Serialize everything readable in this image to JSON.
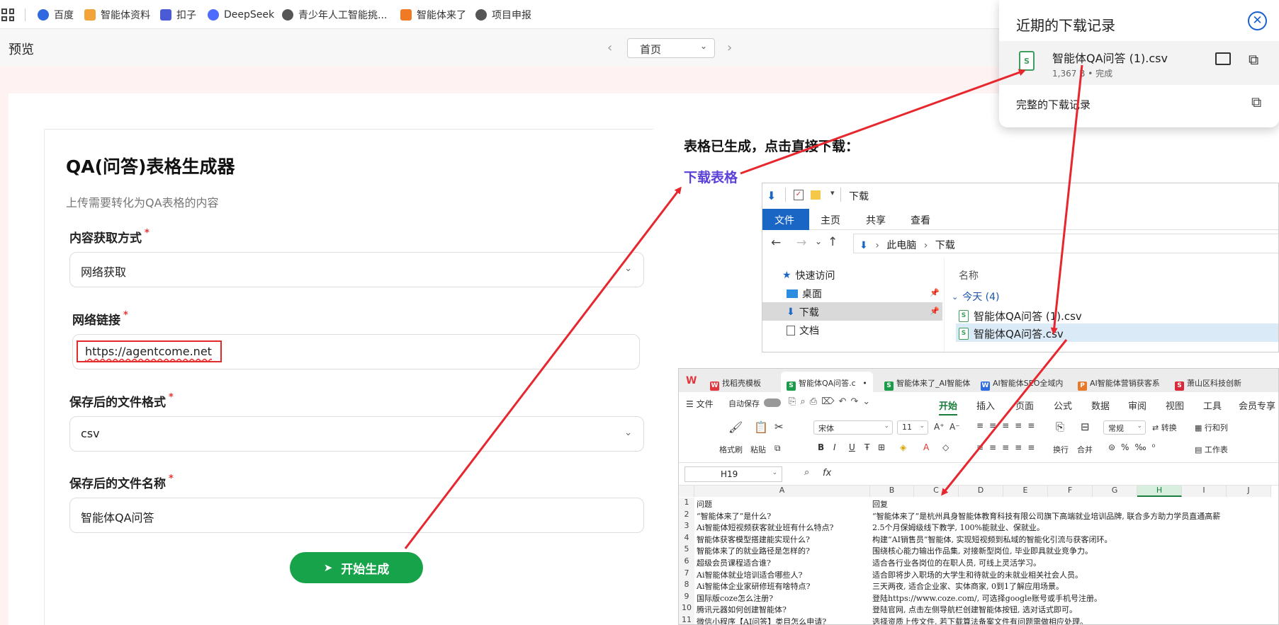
{
  "bookmarks": {
    "items": [
      {
        "label": "百度",
        "color": "#3068e0"
      },
      {
        "label": "智能体资料",
        "color": "#f2a33a"
      },
      {
        "label": "扣子",
        "color": "#4b5bd6"
      },
      {
        "label": "DeepSeek",
        "color": "#4d6bfe"
      },
      {
        "label": "青少年人工智能挑...",
        "color": "#555555"
      },
      {
        "label": "智能体来了",
        "color": "#f07a24"
      },
      {
        "label": "项目申报",
        "color": "#555555"
      }
    ]
  },
  "preview": {
    "title": "预览",
    "page_select": "首页"
  },
  "form": {
    "title": "QA(问答)表格生成器",
    "subtitle": "上传需要转化为QA表格的内容",
    "fields": [
      {
        "label": "内容获取方式",
        "value": "网络获取"
      },
      {
        "label": "网络链接",
        "value": "https://agentcome.net"
      },
      {
        "label": "保存后的文件格式",
        "value": "csv"
      },
      {
        "label": "保存后的文件名称",
        "value": "智能体QA问答"
      }
    ],
    "required_mark": "*",
    "generate_button": "开始生成"
  },
  "result": {
    "ready_text": "表格已生成，点击直接下载：",
    "download_link": "下载表格"
  },
  "downloads_popup": {
    "title": "近期的下载记录",
    "file_name": "智能体QA问答 (1).csv",
    "file_meta": "1,367 B • 完成",
    "full_history": "完整的下载记录"
  },
  "explorer": {
    "title": "下载",
    "ribbon_tabs": [
      "文件",
      "主页",
      "共享",
      "查看"
    ],
    "breadcrumb": [
      "此电脑",
      "下载"
    ],
    "nav": [
      "快速访问",
      "桌面",
      "下载",
      "文档"
    ],
    "column_name": "名称",
    "group": "今天 (4)",
    "files": [
      "智能体QA问答 (1).csv",
      "智能体QA问答.csv"
    ]
  },
  "spreadsheet": {
    "tabs": [
      {
        "label": "找稻壳模板",
        "color": "#e0383e",
        "ico": "W"
      },
      {
        "label": "智能体QA问答.c",
        "color": "#1a9c4b",
        "ico": "S"
      },
      {
        "label": "智能体来了_AI智能体",
        "color": "#1a9c4b",
        "ico": "S"
      },
      {
        "label": "AI智能体SEO全域内",
        "color": "#2d6be0",
        "ico": "W"
      },
      {
        "label": "AI智能体营销获客系",
        "color": "#e8782a",
        "ico": "P"
      },
      {
        "label": "萧山区科技创新",
        "color": "#d8283a",
        "ico": "S"
      }
    ],
    "menu_left": [
      "文件",
      "自动保存"
    ],
    "menu_tabs": [
      "开始",
      "插入",
      "页面",
      "公式",
      "数据",
      "审阅",
      "视图",
      "工具",
      "会员专享"
    ],
    "font_name": "宋体",
    "font_size": "11",
    "number_format": "常规",
    "tool_labels": [
      "格式刷",
      "粘贴",
      "换行",
      "合并",
      "转换",
      "行和列",
      "工作表"
    ],
    "cell_ref": "H19",
    "fx_label": "fx",
    "columns": [
      "A",
      "B",
      "C",
      "D",
      "E",
      "F",
      "G",
      "H",
      "I",
      "J"
    ],
    "selected_column": "H",
    "rows": [
      [
        "1",
        "问题",
        "回复"
      ],
      [
        "2",
        "“智能体来了”是什么?",
        "“智能体来了”是杭州具身智能体教育科技有限公司旗下高端就业培训品牌, 联合多方助力学员直通高薪"
      ],
      [
        "3",
        "Ai智能体短视频获客就业班有什么特点?",
        "2.5个月保姆级线下教学, 100%能就业、保就业。"
      ],
      [
        "4",
        "智能体获客模型搭建能实现什么?",
        "构建“AI销售员”智能体, 实现短视频到私域的智能化引流与获客闭环。"
      ],
      [
        "5",
        "智能体来了的就业路径是怎样的?",
        "围绕核心能力输出作品集, 对接新型岗位, 毕业即具就业竞争力。"
      ],
      [
        "6",
        "超级会员课程适合谁?",
        "适合各行业各岗位的在职人员, 可线上灵活学习。"
      ],
      [
        "7",
        "Ai智能体就业培训适合哪些人?",
        "适合即将步入职场的大学生和待就业的未就业相关社会人员。"
      ],
      [
        "8",
        "Ai智能体企业家研修班有啥特点?",
        "三天两夜, 适合企业家、实体商家, 0到1了解应用场景。"
      ],
      [
        "9",
        "国际版coze怎么注册?",
        "登陆https://www.coze.com/, 可选择google账号或手机号注册。"
      ],
      [
        "10",
        "腾讯元器如何创建智能体?",
        "登陆官网, 点击左侧导航栏创建智能体按钮, 选对话式即可。"
      ],
      [
        "11",
        "微信小程序【AI问答】类目怎么申请?",
        "选择资质上传文件, 若下载算法备案文件有问题需做相应处理。"
      ]
    ]
  }
}
